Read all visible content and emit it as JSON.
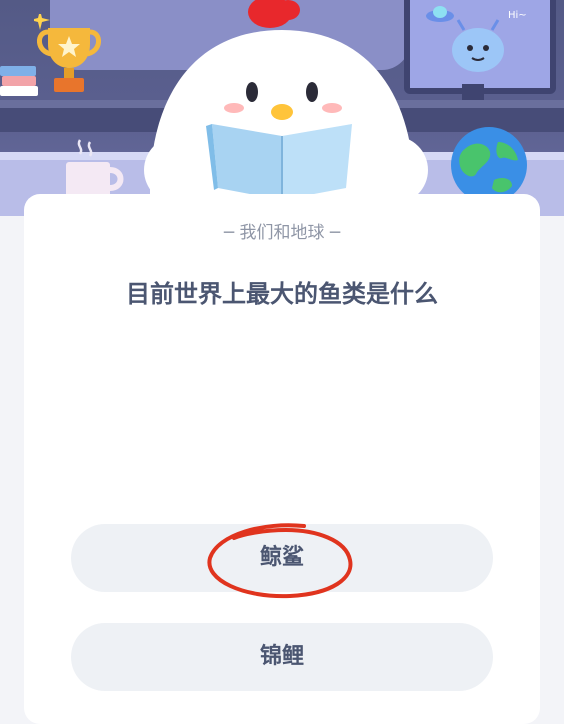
{
  "hero": {
    "alien_greeting": "Hi~"
  },
  "quiz": {
    "category": "我们和地球",
    "question": "目前世界上最大的鱼类是什么",
    "options": [
      {
        "label": "鲸鲨"
      },
      {
        "label": "锦鲤"
      }
    ]
  },
  "colors": {
    "question_text": "#4b5671",
    "option_bg": "#eef1f5",
    "annotation_circle": "#e0341e"
  }
}
